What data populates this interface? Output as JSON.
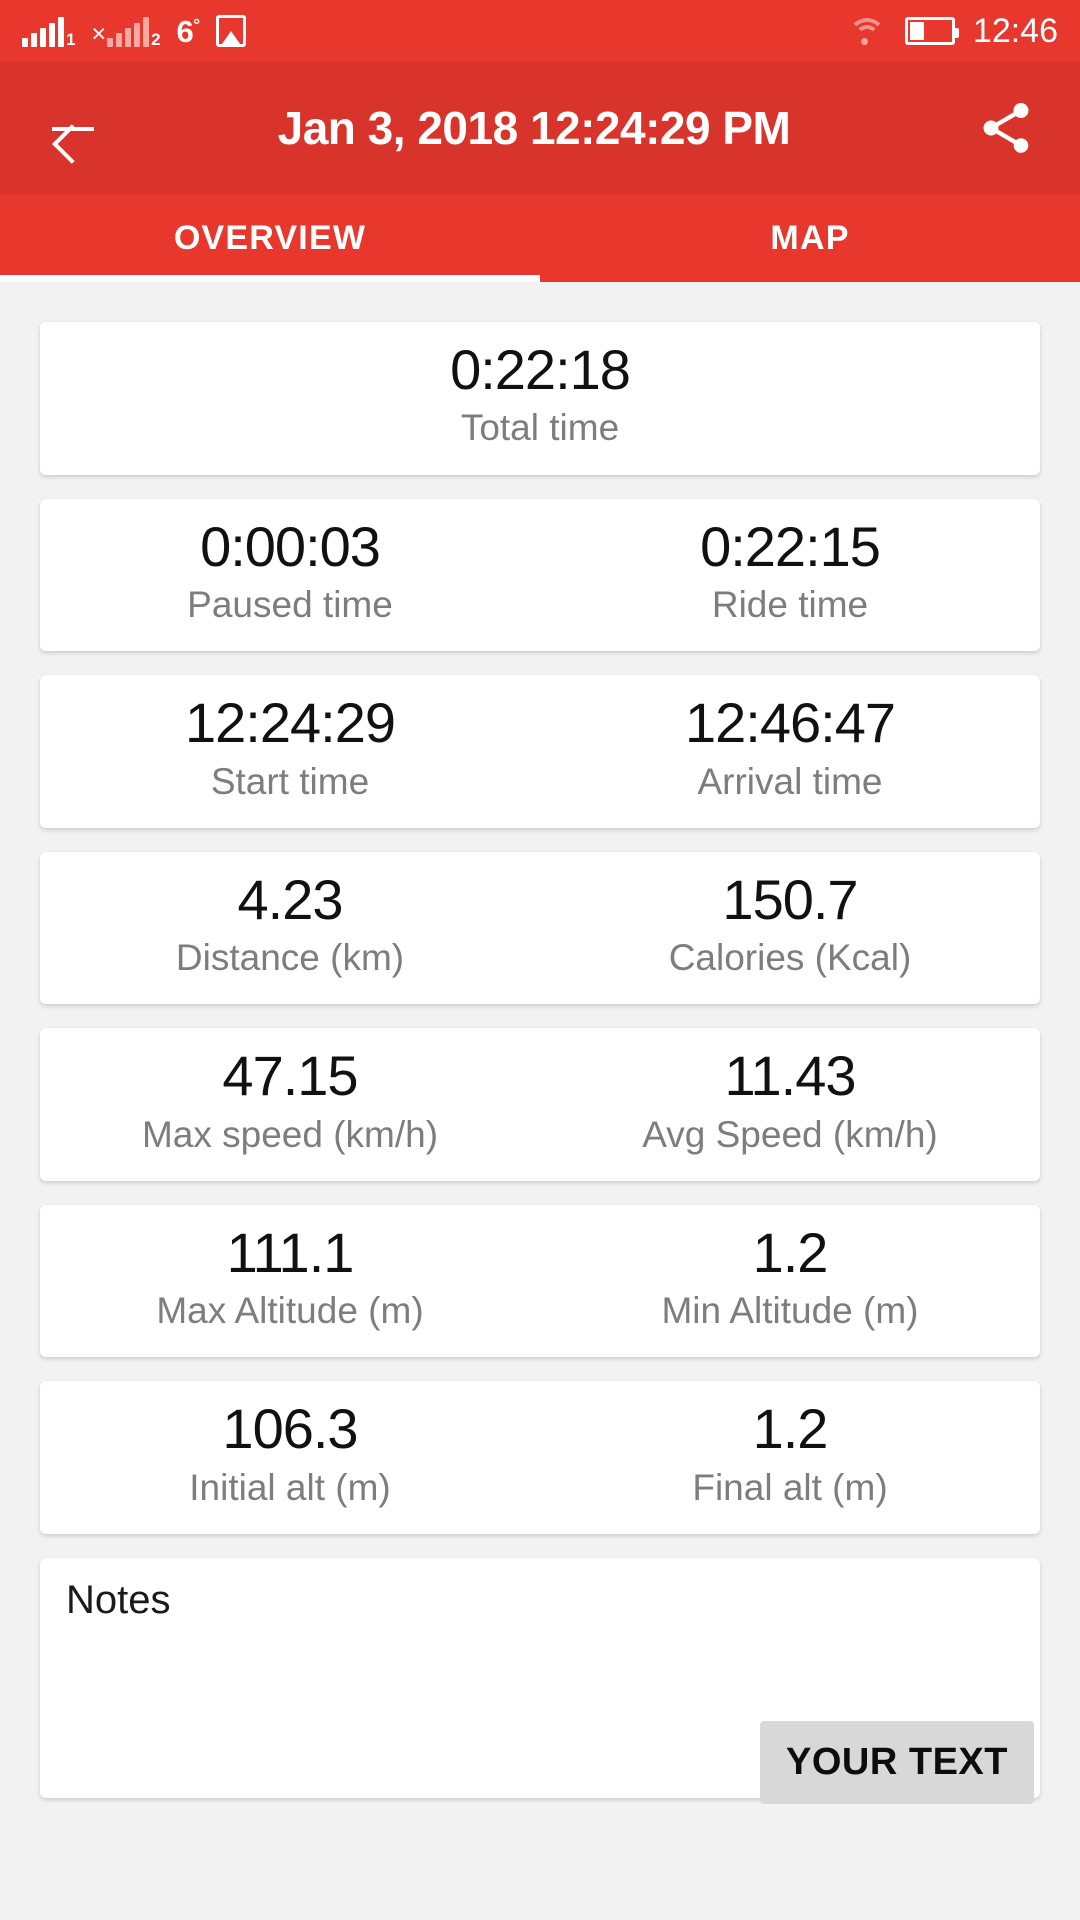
{
  "statusbar": {
    "sim1_label": "1",
    "sim2_label": "2",
    "sim2_x": "×",
    "temperature": "6",
    "temperature_unit": "°",
    "clock": "12:46",
    "icons": [
      "signal-sim1-icon",
      "signal-sim2-icon",
      "photo-icon",
      "wifi-icon",
      "battery-icon"
    ]
  },
  "appbar": {
    "title": "Jan 3, 2018 12:24:29 PM",
    "back_icon": "back-arrow-icon",
    "share_icon": "share-icon"
  },
  "tabs": {
    "items": [
      {
        "label": "OVERVIEW",
        "active": true
      },
      {
        "label": "MAP",
        "active": false
      }
    ]
  },
  "stats": {
    "total": {
      "value": "0:22:18",
      "label": "Total time"
    },
    "rows": [
      {
        "left": {
          "value": "0:00:03",
          "label": "Paused time"
        },
        "right": {
          "value": "0:22:15",
          "label": "Ride time"
        }
      },
      {
        "left": {
          "value": "12:24:29",
          "label": "Start time"
        },
        "right": {
          "value": "12:46:47",
          "label": "Arrival time"
        }
      },
      {
        "left": {
          "value": "4.23",
          "label": "Distance (km)"
        },
        "right": {
          "value": "150.7",
          "label": "Calories (Kcal)"
        }
      },
      {
        "left": {
          "value": "47.15",
          "label": "Max speed (km/h)"
        },
        "right": {
          "value": "11.43",
          "label": "Avg Speed (km/h)"
        }
      },
      {
        "left": {
          "value": "111.1",
          "label": "Max Altitude (m)"
        },
        "right": {
          "value": "1.2",
          "label": "Min Altitude (m)"
        }
      },
      {
        "left": {
          "value": "106.3",
          "label": "Initial alt (m)"
        },
        "right": {
          "value": "1.2",
          "label": "Final alt (m)"
        }
      }
    ]
  },
  "notes": {
    "label": "Notes",
    "value": "",
    "button_label": "YOUR TEXT"
  },
  "colors": {
    "status_red": "#e8372c",
    "appbar_red": "#d8342b",
    "tab_red": "#e8372c",
    "page_bg": "#f2f2f2",
    "card_bg": "#ffffff",
    "value_text": "#111111",
    "label_text": "#7d7d7d",
    "button_bg": "#d8d8d8"
  }
}
